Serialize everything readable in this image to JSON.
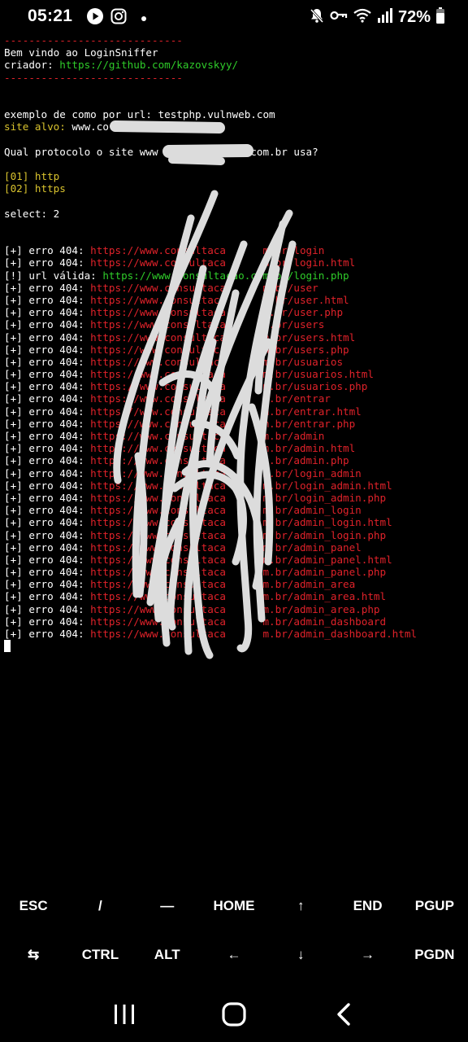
{
  "status": {
    "time": "05:21",
    "battery": "72%",
    "left_icons": [
      "youtube-icon",
      "instagram-icon",
      "notification-dot-icon"
    ],
    "right_icons": [
      "mute-icon",
      "vpn-key-icon",
      "wifi-icon",
      "signal-icon",
      "battery-icon"
    ]
  },
  "terminal": {
    "lines": [
      {
        "segments": [
          {
            "text": "-----------------------------",
            "color": "red"
          }
        ]
      },
      {
        "segments": [
          {
            "text": "Bem vindo ao LoginSniffer",
            "color": "white"
          }
        ]
      },
      {
        "segments": [
          {
            "text": "criador: ",
            "color": "white"
          },
          {
            "text": "https://github.com/kazovskyy/",
            "color": "green"
          }
        ]
      },
      {
        "segments": [
          {
            "text": "-----------------------------",
            "color": "red"
          }
        ]
      },
      {
        "segments": []
      },
      {
        "segments": []
      },
      {
        "segments": [
          {
            "text": "exemplo de como por url: testphp.vulnweb.com",
            "color": "white"
          }
        ]
      },
      {
        "segments": [
          {
            "text": "site alvo: ",
            "color": "yellow"
          },
          {
            "text": "www.co             om.br",
            "color": "white"
          }
        ]
      },
      {
        "segments": []
      },
      {
        "segments": [
          {
            "text": "Qual protocolo o site www              .com.br usa?",
            "color": "white"
          }
        ]
      },
      {
        "segments": []
      },
      {
        "segments": [
          {
            "text": "[01] http",
            "color": "yellow"
          }
        ]
      },
      {
        "segments": [
          {
            "text": "[02] https",
            "color": "yellow"
          }
        ]
      },
      {
        "segments": []
      },
      {
        "segments": [
          {
            "text": "select: 2",
            "color": "white"
          }
        ]
      },
      {
        "segments": []
      },
      {
        "segments": []
      },
      {
        "segments": [
          {
            "text": "[+] erro 404: ",
            "color": "white"
          },
          {
            "text": "https://www.consultaca      m.br/login",
            "color": "red"
          }
        ]
      },
      {
        "segments": [
          {
            "text": "[+] erro 404: ",
            "color": "white"
          },
          {
            "text": "https://www.consultaca      m.br/login.html",
            "color": "red"
          }
        ]
      },
      {
        "segments": [
          {
            "text": "[!] url válida: ",
            "color": "white"
          },
          {
            "text": "https://www.consultacao.com.br/login.php",
            "color": "green"
          }
        ]
      },
      {
        "segments": [
          {
            "text": "[+] erro 404: ",
            "color": "white"
          },
          {
            "text": "https://www.consultaca      m.br/user",
            "color": "red"
          }
        ]
      },
      {
        "segments": [
          {
            "text": "[+] erro 404: ",
            "color": "white"
          },
          {
            "text": "https://www.consultaca      m.br/user.html",
            "color": "red"
          }
        ]
      },
      {
        "segments": [
          {
            "text": "[+] erro 404: ",
            "color": "white"
          },
          {
            "text": "https://www.consultaca      m.br/user.php",
            "color": "red"
          }
        ]
      },
      {
        "segments": [
          {
            "text": "[+] erro 404: ",
            "color": "white"
          },
          {
            "text": "https://www.consultaca      m.br/users",
            "color": "red"
          }
        ]
      },
      {
        "segments": [
          {
            "text": "[+] erro 404: ",
            "color": "white"
          },
          {
            "text": "https://www.consultaca      m.br/users.html",
            "color": "red"
          }
        ]
      },
      {
        "segments": [
          {
            "text": "[+] erro 404: ",
            "color": "white"
          },
          {
            "text": "https://www.consultaca      m.br/users.php",
            "color": "red"
          }
        ]
      },
      {
        "segments": [
          {
            "text": "[+] erro 404: ",
            "color": "white"
          },
          {
            "text": "https://www.consultaca      m.br/usuarios",
            "color": "red"
          }
        ]
      },
      {
        "segments": [
          {
            "text": "[+] erro 404: ",
            "color": "white"
          },
          {
            "text": "https://www.consultaca      m.br/usuarios.html",
            "color": "red"
          }
        ]
      },
      {
        "segments": [
          {
            "text": "[+] erro 404: ",
            "color": "white"
          },
          {
            "text": "https://www.consultaca      m.br/usuarios.php",
            "color": "red"
          }
        ]
      },
      {
        "segments": [
          {
            "text": "[+] erro 404: ",
            "color": "white"
          },
          {
            "text": "https://www.consultaca      m.br/entrar",
            "color": "red"
          }
        ]
      },
      {
        "segments": [
          {
            "text": "[+] erro 404: ",
            "color": "white"
          },
          {
            "text": "https://www.consultaca      m.br/entrar.html",
            "color": "red"
          }
        ]
      },
      {
        "segments": [
          {
            "text": "[+] erro 404: ",
            "color": "white"
          },
          {
            "text": "https://www.consultaca      m.br/entrar.php",
            "color": "red"
          }
        ]
      },
      {
        "segments": [
          {
            "text": "[+] erro 404: ",
            "color": "white"
          },
          {
            "text": "https://www.consultaca      m.br/admin",
            "color": "red"
          }
        ]
      },
      {
        "segments": [
          {
            "text": "[+] erro 404: ",
            "color": "white"
          },
          {
            "text": "https://www.consultaca      m.br/admin.html",
            "color": "red"
          }
        ]
      },
      {
        "segments": [
          {
            "text": "[+] erro 404: ",
            "color": "white"
          },
          {
            "text": "https://www.consultaca      m.br/admin.php",
            "color": "red"
          }
        ]
      },
      {
        "segments": [
          {
            "text": "[+] erro 404: ",
            "color": "white"
          },
          {
            "text": "https://www.consultaca      m.br/login_admin",
            "color": "red"
          }
        ]
      },
      {
        "segments": [
          {
            "text": "[+] erro 404: ",
            "color": "white"
          },
          {
            "text": "https://www.consultaca      m.br/login_admin.html",
            "color": "red"
          }
        ]
      },
      {
        "segments": [
          {
            "text": "[+] erro 404: ",
            "color": "white"
          },
          {
            "text": "https://www.consultaca      m.br/login_admin.php",
            "color": "red"
          }
        ]
      },
      {
        "segments": [
          {
            "text": "[+] erro 404: ",
            "color": "white"
          },
          {
            "text": "https://www.consultaca      m.br/admin_login",
            "color": "red"
          }
        ]
      },
      {
        "segments": [
          {
            "text": "[+] erro 404: ",
            "color": "white"
          },
          {
            "text": "https://www.consultaca      m.br/admin_login.html",
            "color": "red"
          }
        ]
      },
      {
        "segments": [
          {
            "text": "[+] erro 404: ",
            "color": "white"
          },
          {
            "text": "https://www.consultaca      m.br/admin_login.php",
            "color": "red"
          }
        ]
      },
      {
        "segments": [
          {
            "text": "[+] erro 404: ",
            "color": "white"
          },
          {
            "text": "https://www.consultaca      m.br/admin_panel",
            "color": "red"
          }
        ]
      },
      {
        "segments": [
          {
            "text": "[+] erro 404: ",
            "color": "white"
          },
          {
            "text": "https://www.consultaca      m.br/admin_panel.html",
            "color": "red"
          }
        ]
      },
      {
        "segments": [
          {
            "text": "[+] erro 404: ",
            "color": "white"
          },
          {
            "text": "https://www.consultaca      m.br/admin_panel.php",
            "color": "red"
          }
        ]
      },
      {
        "segments": [
          {
            "text": "[+] erro 404: ",
            "color": "white"
          },
          {
            "text": "https://www.consultaca      m.br/admin_area",
            "color": "red"
          }
        ]
      },
      {
        "segments": [
          {
            "text": "[+] erro 404: ",
            "color": "white"
          },
          {
            "text": "https://www.consultaca      m.br/admin_area.html",
            "color": "red"
          }
        ]
      },
      {
        "segments": [
          {
            "text": "[+] erro 404: ",
            "color": "white"
          },
          {
            "text": "https://www.consultaca      m.br/admin_area.php",
            "color": "red"
          }
        ]
      },
      {
        "segments": [
          {
            "text": "[+] erro 404: ",
            "color": "white"
          },
          {
            "text": "https://www.consultaca      m.br/admin_dashboard",
            "color": "red"
          }
        ]
      },
      {
        "segments": [
          {
            "text": "[+] erro 404: ",
            "color": "white"
          },
          {
            "text": "https://www.consultaca      m.br/admin_dashboard.html",
            "color": "red"
          }
        ]
      }
    ]
  },
  "extra_keys": {
    "row1": [
      "ESC",
      "/",
      "—",
      "HOME",
      "↑",
      "END",
      "PGUP"
    ],
    "row2": [
      "⇆",
      "CTRL",
      "ALT",
      "←",
      "↓",
      "→",
      "PGDN"
    ]
  },
  "navbar": [
    "recent-apps-icon",
    "home-icon",
    "back-icon"
  ],
  "colors": {
    "red": "#e0222a",
    "green": "#2fcc2a",
    "yellow": "#d9c32e",
    "background": "#000000"
  }
}
